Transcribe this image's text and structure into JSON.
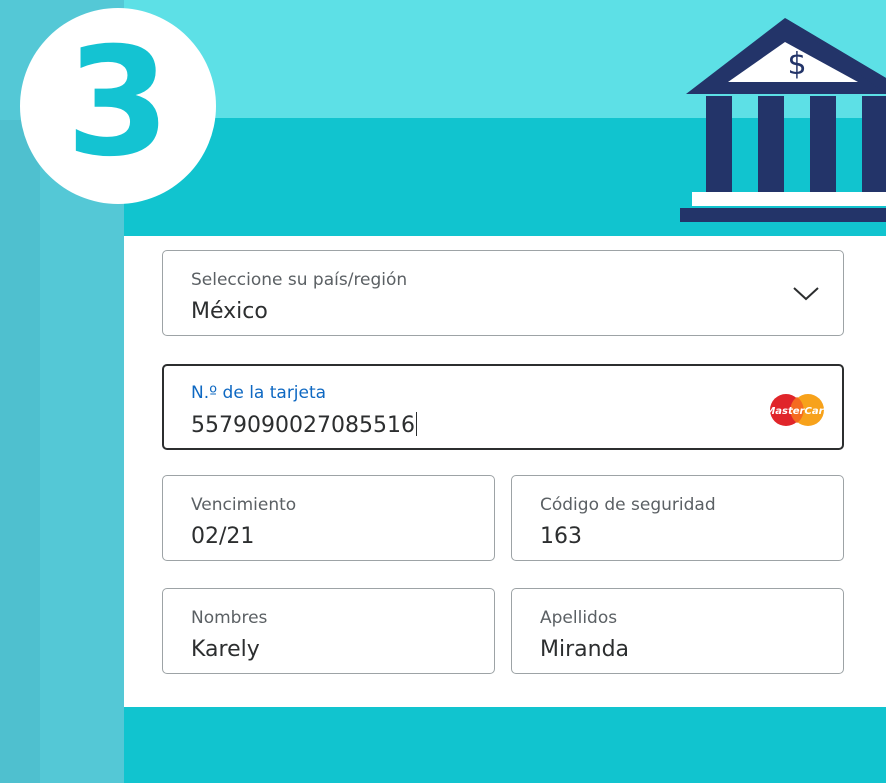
{
  "step_number": "3",
  "form": {
    "country": {
      "label": "Seleccione su país/región",
      "value": "México"
    },
    "card_number": {
      "label": "N.º de la tarjeta",
      "value": "5579090027085516",
      "brand_icon": "mastercard-icon",
      "brand_text": "MasterCard"
    },
    "expiry": {
      "label": "Vencimiento",
      "value": "02/21"
    },
    "security_code": {
      "label": "Código de seguridad",
      "value": "163"
    },
    "first_name": {
      "label": "Nombres",
      "value": "Karely"
    },
    "last_name": {
      "label": "Apellidos",
      "value": "Miranda"
    }
  },
  "bank_icon": {
    "symbol": "$"
  },
  "colors": {
    "background": "#11c4cf",
    "top_band": "#5de0e6",
    "bank": "#233469",
    "label_active": "#0e68c2"
  }
}
